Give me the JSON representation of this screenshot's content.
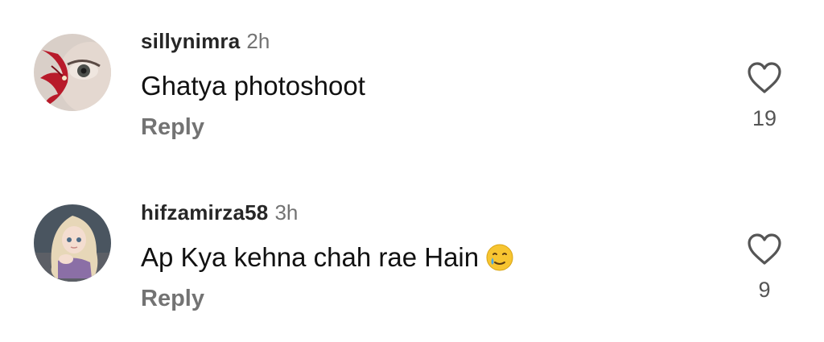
{
  "comments": [
    {
      "username": "sillynimra",
      "time": "2h",
      "text": "Ghatya photoshoot",
      "reply_label": "Reply",
      "likes": "19",
      "avatar_icon": "avatar-eye-flower",
      "heart_icon": "heart-outline-icon"
    },
    {
      "username": "hifzamirza58",
      "time": "3h",
      "text": "Ap Kya kehna chah rae Hain",
      "emoji_icon": "smiling-face-with-tear-emoji",
      "reply_label": "Reply",
      "likes": "9",
      "avatar_icon": "avatar-cartoon-girl",
      "heart_icon": "heart-outline-icon"
    }
  ],
  "colors": {
    "username": "#262626",
    "secondary": "#737373",
    "text": "#111111",
    "background": "#ffffff"
  }
}
